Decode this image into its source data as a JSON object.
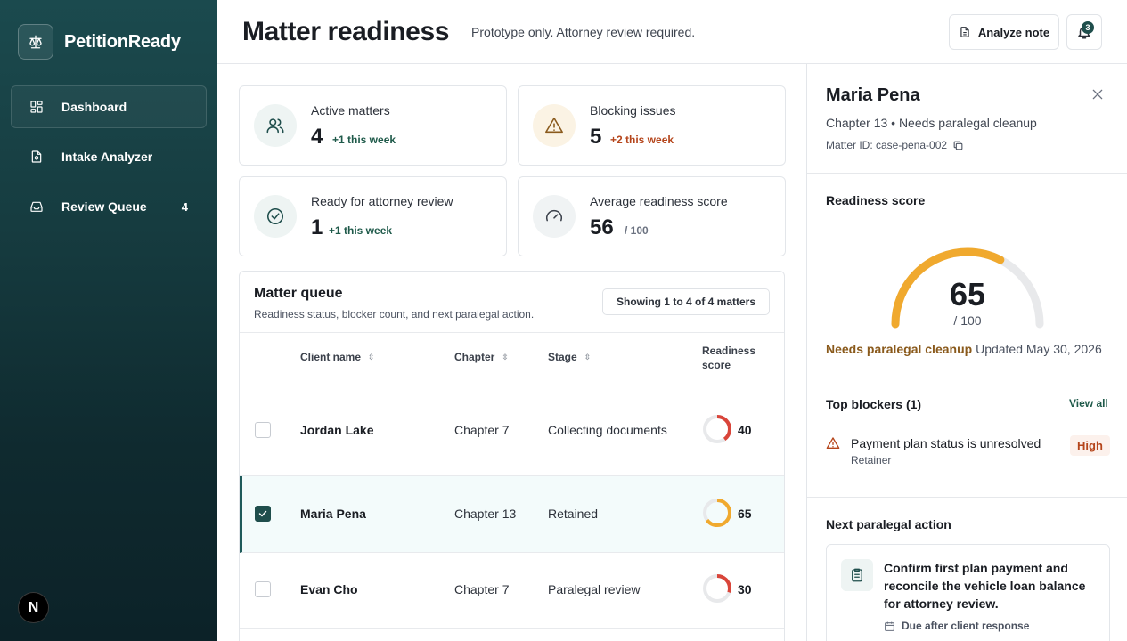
{
  "app": {
    "name": "PetitionReady"
  },
  "sidebar": {
    "items": [
      {
        "label": "Dashboard",
        "icon": "dashboard-icon",
        "active": true,
        "count": ""
      },
      {
        "label": "Intake Analyzer",
        "icon": "document-icon",
        "active": false,
        "count": ""
      },
      {
        "label": "Review Queue",
        "icon": "inbox-icon",
        "active": false,
        "count": "4"
      }
    ],
    "footer_badge": "N"
  },
  "header": {
    "title": "Matter readiness",
    "subtitle": "Prototype only. Attorney review required.",
    "analyze_label": "Analyze note",
    "notification_count": "3"
  },
  "stats": [
    {
      "label": "Active matters",
      "value": "4",
      "delta": "+1 this week",
      "icon": "users-icon"
    },
    {
      "label": "Blocking issues",
      "value": "5",
      "delta": "+2 this week",
      "icon": "warning-icon"
    },
    {
      "label": "Ready for attorney review",
      "value": "1",
      "delta": "+1 this week",
      "icon": "check-circle-icon"
    },
    {
      "label": "Average readiness score",
      "value": "56",
      "delta": "/ 100",
      "icon": "gauge-icon"
    }
  ],
  "queue": {
    "title": "Matter queue",
    "subtitle": "Readiness status, blocker count, and next paralegal action.",
    "showing": "Showing 1 to 4 of 4 matters",
    "columns": [
      "Client name",
      "Chapter",
      "Stage",
      "Readiness score"
    ],
    "rows": [
      {
        "name": "Jordan Lake",
        "chapter": "Chapter 7",
        "stage": "Collecting documents",
        "score": 40,
        "selected": false,
        "color": "#d9453a"
      },
      {
        "name": "Maria Pena",
        "chapter": "Chapter 13",
        "stage": "Retained",
        "score": 65,
        "selected": true,
        "color": "#f0a92e"
      },
      {
        "name": "Evan Cho",
        "chapter": "Chapter 7",
        "stage": "Paralegal review",
        "score": 30,
        "selected": false,
        "color": "#d9453a"
      }
    ]
  },
  "detail": {
    "name": "Maria Pena",
    "meta": "Chapter 13 • Needs paralegal cleanup",
    "matter_id": "Matter ID: case-pena-002",
    "readiness_heading": "Readiness score",
    "score": 65,
    "score_max": "/ 100",
    "status": "Needs paralegal cleanup",
    "updated": "Updated May 30, 2026",
    "blockers_heading": "Top blockers (1)",
    "view_all": "View all",
    "blocker": {
      "title": "Payment plan status is unresolved",
      "category": "Retainer",
      "severity": "High"
    },
    "next_heading": "Next paralegal action",
    "next_action": "Confirm first plan payment and reconcile the vehicle loan balance for attorney review.",
    "due": "Due after client response"
  },
  "colors": {
    "accent": "#1f4e4c",
    "gauge": "#f0a92e",
    "danger": "#d9453a"
  }
}
